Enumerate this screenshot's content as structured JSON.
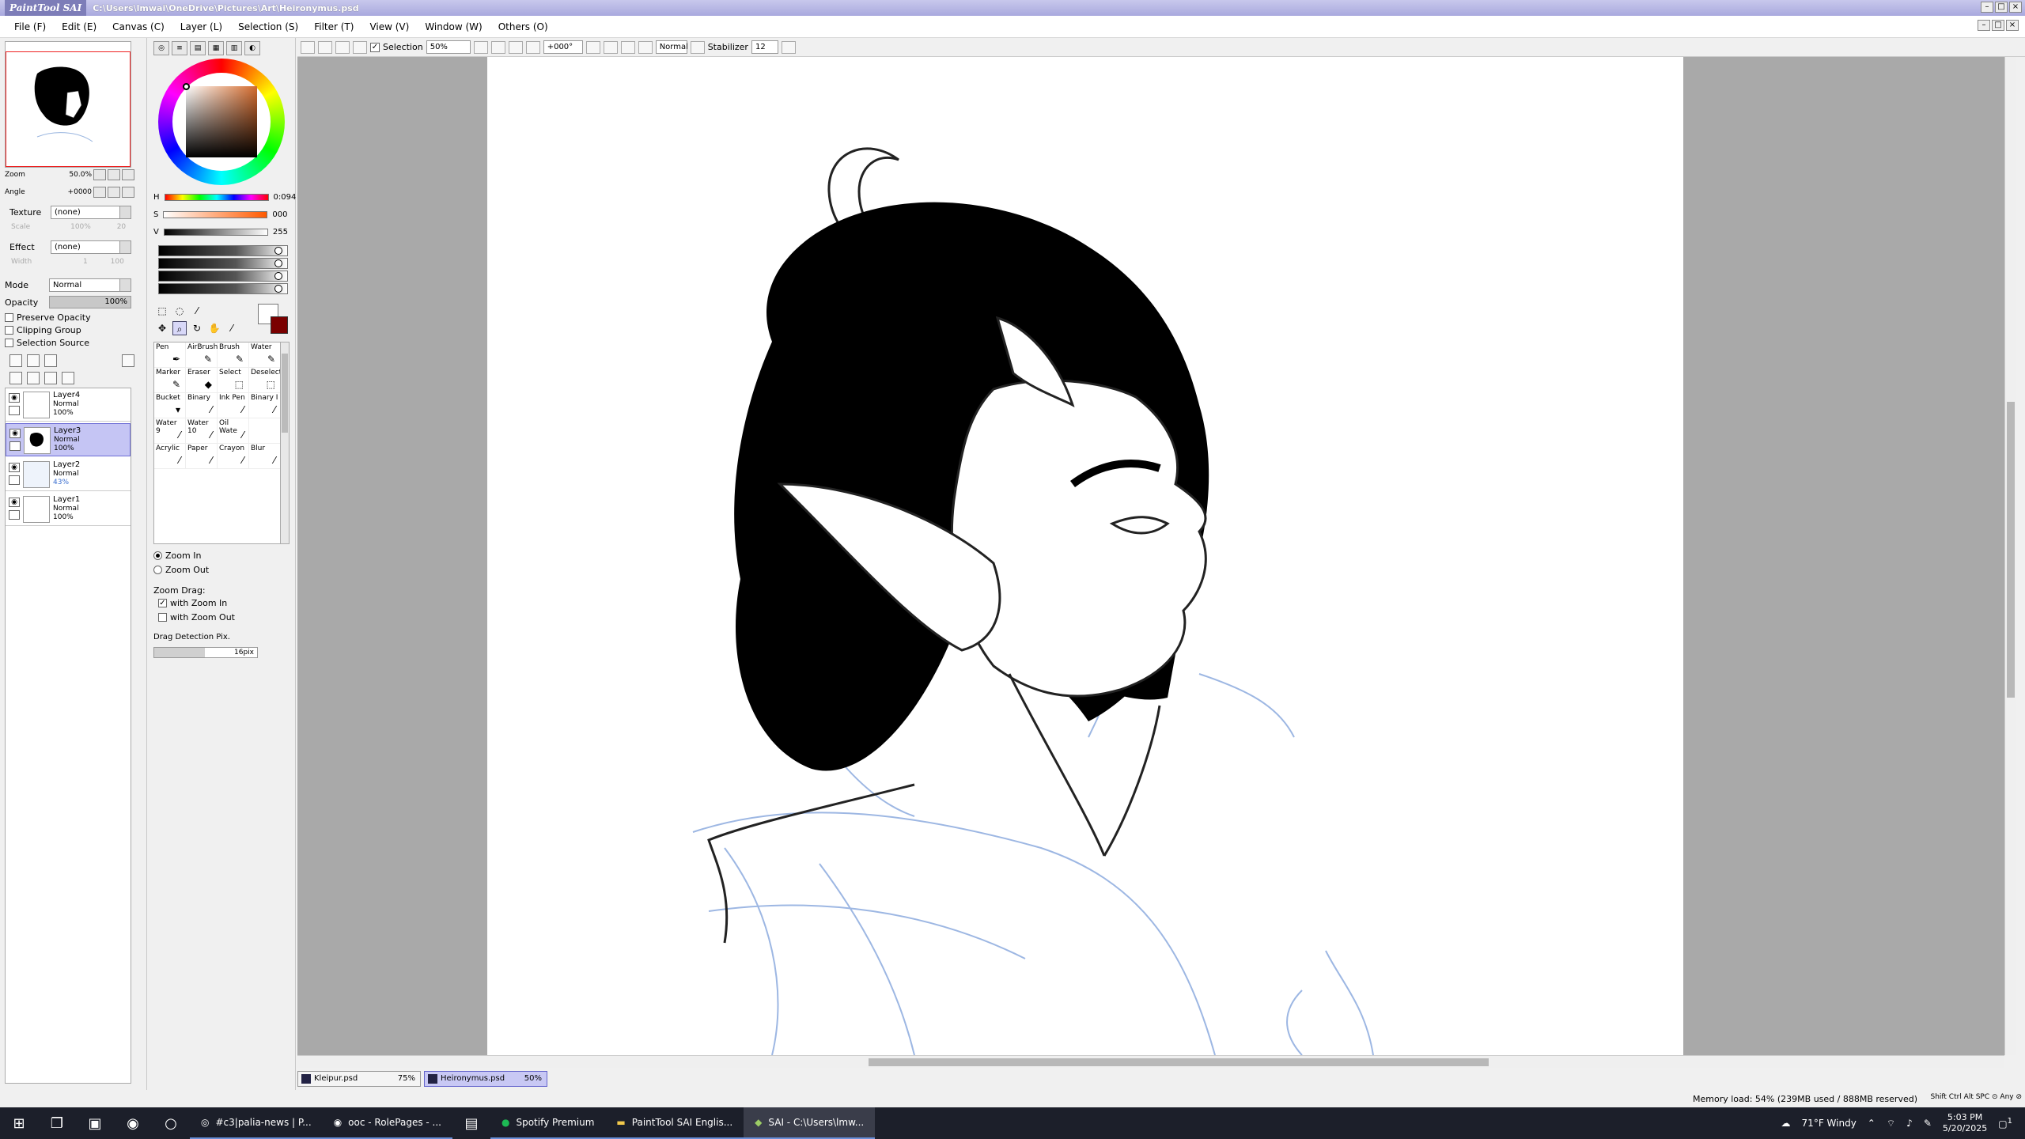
{
  "titlebar": {
    "app_logo": "PaintTool SAI",
    "path": "C:\\Users\\lmwai\\OneDrive\\Pictures\\Art\\Heironymus.psd"
  },
  "menu": [
    "File (F)",
    "Edit (E)",
    "Canvas (C)",
    "Layer (L)",
    "Selection (S)",
    "Filter (T)",
    "View (V)",
    "Window (W)",
    "Others (O)"
  ],
  "navigator": {
    "zoom_label": "Zoom",
    "zoom_value": "50.0%",
    "angle_label": "Angle",
    "angle_value": "+0000"
  },
  "layer_props": {
    "texture_label": "Texture",
    "texture_value": "(none)",
    "scale_label": "Scale",
    "scale_value": "100%",
    "scale_num": "20",
    "effect_label": "Effect",
    "effect_value": "(none)",
    "width_label": "Width",
    "width_value": "1",
    "width_num": "100",
    "mode_label": "Mode",
    "mode_value": "Normal",
    "opacity_label": "Opacity",
    "opacity_value": "100%",
    "preserve_opacity": "Preserve Opacity",
    "clipping_group": "Clipping Group",
    "selection_source": "Selection Source"
  },
  "layers": [
    {
      "name": "Layer4",
      "mode": "Normal",
      "opacity": "100%",
      "selected": false
    },
    {
      "name": "Layer3",
      "mode": "Normal",
      "opacity": "100%",
      "selected": true
    },
    {
      "name": "Layer2",
      "mode": "Normal",
      "opacity": "43%",
      "selected": false
    },
    {
      "name": "Layer1",
      "mode": "Normal",
      "opacity": "100%",
      "selected": false
    }
  ],
  "color": {
    "h_label": "H",
    "h_value": "0:094",
    "s_label": "S",
    "s_value": "000",
    "v_label": "V",
    "v_value": "255",
    "fg": "#ffffff",
    "bg": "#7a0000"
  },
  "brushes": [
    [
      "Pen",
      "AirBrush",
      "Brush",
      "Water"
    ],
    [
      "Marker",
      "Eraser",
      "Select",
      "Deselect"
    ],
    [
      "Bucket",
      "Binary",
      "Ink Pen",
      "Binary I"
    ],
    [
      "Water",
      "Water",
      "Oil Wate",
      ""
    ],
    [
      "Acrylic",
      "Paper",
      "Crayon",
      "Blur"
    ]
  ],
  "brush_sizes": {
    "water9": "9",
    "water10": "10"
  },
  "zoom_tool": {
    "zoom_in": "Zoom In",
    "zoom_out": "Zoom Out",
    "zoom_drag": "Zoom Drag:",
    "with_zoom_in": "with Zoom In",
    "with_zoom_out": "with Zoom Out",
    "drag_detection": "Drag Detection Pix.",
    "drag_value": "16pix"
  },
  "canvas_toolbar": {
    "selection_label": "Selection",
    "zoom_value": "50%",
    "angle_value": "+000°",
    "blend_value": "Normal",
    "stabilizer_label": "Stabilizer",
    "stabilizer_value": "12"
  },
  "doc_tabs": [
    {
      "name": "Kleipur.psd",
      "zoom": "75%",
      "active": false
    },
    {
      "name": "Heironymus.psd",
      "zoom": "50%",
      "active": true
    }
  ],
  "status": {
    "memory": "Memory load: 54% (239MB used / 888MB reserved)",
    "keys": "Shift Ctrl Alt SPC ⊙ Any ⊘"
  },
  "taskbar": {
    "apps": [
      {
        "label": "#c3|palia-news | P...",
        "icon": "discord-icon",
        "active": false
      },
      {
        "label": "ooc - RolePages - ...",
        "icon": "chrome-icon",
        "active": false
      },
      {
        "label": "Spotify Premium",
        "icon": "spotify-icon",
        "active": false
      },
      {
        "label": "PaintTool SAI Englis...",
        "icon": "folder-icon",
        "active": false
      },
      {
        "label": "SAI - C:\\Users\\lmw...",
        "icon": "sai-icon",
        "active": true
      }
    ],
    "weather": "71°F  Windy",
    "time": "5:03 PM",
    "date": "5/20/2025",
    "notif": "1"
  }
}
